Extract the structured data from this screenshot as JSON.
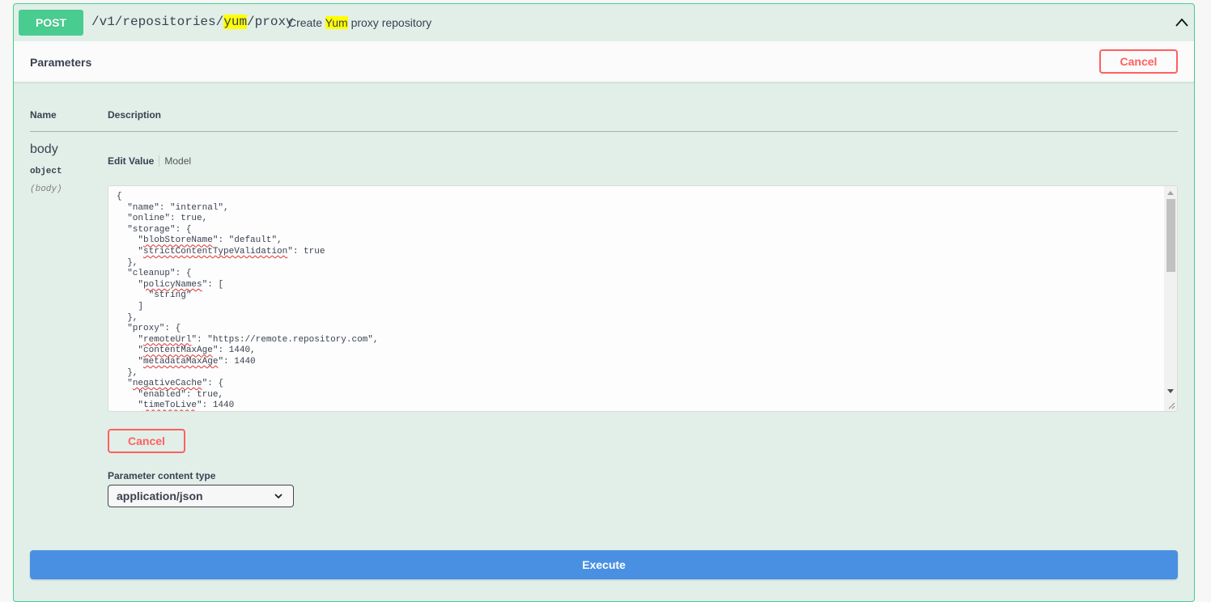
{
  "operation": {
    "method": "POST",
    "path_prefix": "/v1/repositories/",
    "path_highlight": "yum",
    "path_suffix": "/proxy",
    "summary_prefix": "Create ",
    "summary_highlight": "Yum",
    "summary_suffix": " proxy repository"
  },
  "parameters": {
    "title": "Parameters",
    "cancel_label": "Cancel",
    "col_name": "Name",
    "col_description": "Description",
    "param": {
      "name": "body",
      "type": "object",
      "in": "(body)"
    },
    "tabs": {
      "edit": "Edit Value",
      "model": "Model"
    },
    "body_lines": [
      "{",
      "  \"name\": \"internal\",",
      "  \"online\": true,",
      "  \"storage\": {",
      "    \"blobStoreName\": \"default\",",
      "    \"strictContentTypeValidation\": true",
      "  },",
      "  \"cleanup\": {",
      "    \"policyNames\": [",
      "      \"string\"",
      "    ]",
      "  },",
      "  \"proxy\": {",
      "    \"remoteUrl\": \"https://remote.repository.com\",",
      "    \"contentMaxAge\": 1440,",
      "    \"metadataMaxAge\": 1440",
      "  },",
      "  \"negativeCache\": {",
      "    \"enabled\": true,",
      "    \"timeToLive\": 1440"
    ],
    "inner_cancel_label": "Cancel",
    "content_type_label": "Parameter content type",
    "content_type_value": "application/json"
  },
  "execute_label": "Execute",
  "colors": {
    "post_green": "#49cc90",
    "block_bg": "#e1efe8",
    "cancel_red": "#ff6060",
    "execute_blue": "#4990e2"
  }
}
